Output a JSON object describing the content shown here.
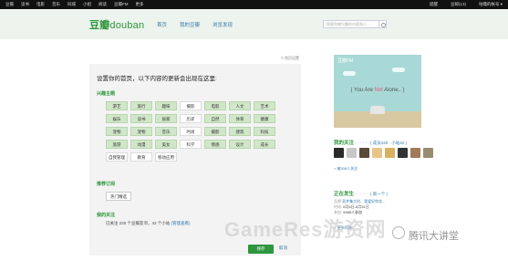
{
  "topbar": {
    "nav": [
      "豆瓣",
      "读书",
      "电影",
      "音乐",
      "同城",
      "小组",
      "阅读",
      "豆瓣FM",
      "更多"
    ],
    "right": [
      "提醒",
      "豆邮(13)",
      "咕噜的帐号 ▾"
    ]
  },
  "header": {
    "logo_cn": "豆瓣",
    "logo_en": "douban",
    "nav": [
      "首页",
      "我的豆瓣",
      "浏览发现"
    ],
    "search_placeholder": "搜索你感兴趣的内容和人..."
  },
  "home_link": "© 首页设置",
  "panel": {
    "title": "设置你的首页，以下内容的更新会出现在这里:",
    "interest_heading": "兴趣主题",
    "tags": [
      {
        "label": "游艺",
        "on": true
      },
      {
        "label": "旅行",
        "on": true
      },
      {
        "label": "趣味",
        "on": true
      },
      {
        "label": "摄影",
        "on": false
      },
      {
        "label": "电影",
        "on": true
      },
      {
        "label": "人文",
        "on": true
      },
      {
        "label": "艺术",
        "on": true
      },
      {
        "label": "娱乐",
        "on": true
      },
      {
        "label": "读书",
        "on": true
      },
      {
        "label": "居家",
        "on": true
      },
      {
        "label": "历史",
        "on": false
      },
      {
        "label": "自然",
        "on": true
      },
      {
        "label": "体育",
        "on": true
      },
      {
        "label": "健康",
        "on": true
      },
      {
        "label": "宠物",
        "on": true
      },
      {
        "label": "宠物",
        "on": true
      },
      {
        "label": "音乐",
        "on": true
      },
      {
        "label": "时尚",
        "on": false
      },
      {
        "label": "摄影",
        "on": true
      },
      {
        "label": "建筑",
        "on": true
      },
      {
        "label": "科技",
        "on": true
      },
      {
        "label": "旅游",
        "on": true
      },
      {
        "label": "动漫",
        "on": true
      },
      {
        "label": "美女",
        "on": true
      },
      {
        "label": "科学",
        "on": false
      },
      {
        "label": "情感",
        "on": true
      },
      {
        "label": "设计",
        "on": true
      },
      {
        "label": "成长",
        "on": true
      },
      {
        "label": "自我管理",
        "on": false
      },
      {
        "label": "教育",
        "on": false
      },
      {
        "label": "移动应用",
        "on": false
      }
    ],
    "subscribe_heading": "推荐订阅",
    "subscribe_button": "热门精选",
    "follow_heading": "我的关注",
    "follow_text": "已关注 220 个豆瓣友邻，42 个小站",
    "follow_link": "(管理查看)",
    "save_label": "保存",
    "cancel_label": "取消"
  },
  "sidebar": {
    "fm_title": "豆瓣FM",
    "fm_slogan_pre": "( You Are ",
    "fm_slogan_not": "Not",
    "fm_slogan_post": " Alone.. )",
    "follow_heading": "我的关注",
    "follow_meta": "· · · · · · ( 成员220 · 小站42 )",
    "avatar_colors": [
      "#2a2a2a",
      "#c7c7c7",
      "#5a4a3a",
      "#e8c48a",
      "#d8b060",
      "#333333",
      "#a27a58",
      "#9a8a70"
    ],
    "follow_more": "> 被208人关注",
    "event_heading": "正在发生",
    "event_meta": "· · · · · · ( 新一个 )",
    "event_lines": [
      {
        "label": "品牌",
        "text": "双井集大时、我爱好你实..."
      },
      {
        "label": "时间:",
        "text": "8月6日-8月31日"
      },
      {
        "label": "参加:",
        "text": "5985人参加"
      }
    ],
    "recent_more": "> 更多同城..."
  },
  "watermark": {
    "main": "GameRes游资网",
    "secondary": "腾讯大讲堂"
  }
}
